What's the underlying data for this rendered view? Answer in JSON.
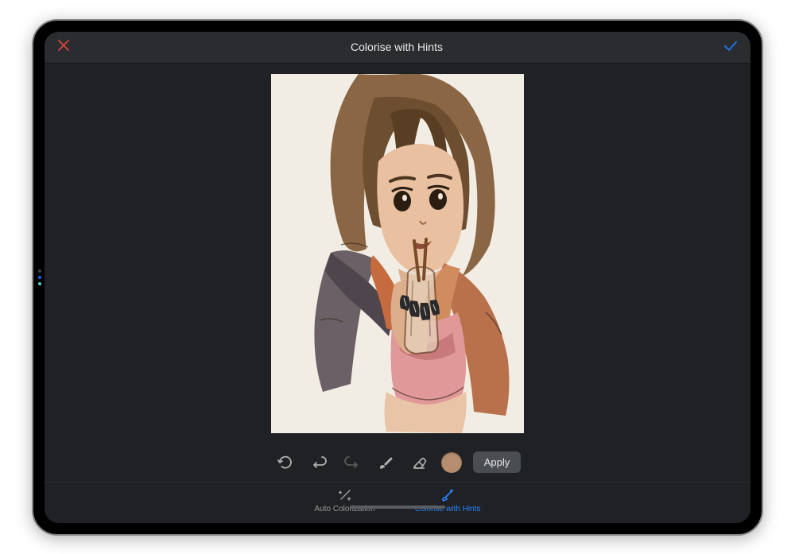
{
  "header": {
    "title": "Colorise with Hints"
  },
  "toolbar": {
    "apply_label": "Apply",
    "selected_color": "#b58d6f"
  },
  "tabs": {
    "auto_label": "Auto Colorization",
    "hints_label": "Colorise with Hints"
  }
}
